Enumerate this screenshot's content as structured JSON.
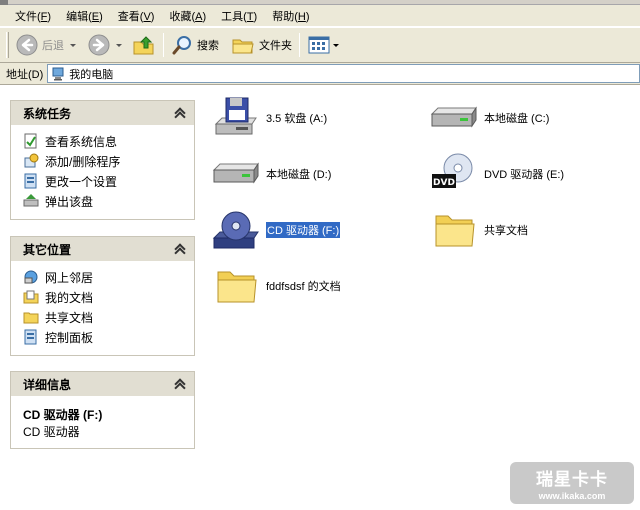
{
  "menubar": {
    "items": [
      {
        "label": "文件(",
        "hotkey": "F",
        "tail": ")"
      },
      {
        "label": "编辑(",
        "hotkey": "E",
        "tail": ")"
      },
      {
        "label": "查看(",
        "hotkey": "V",
        "tail": ")"
      },
      {
        "label": "收藏(",
        "hotkey": "A",
        "tail": ")"
      },
      {
        "label": "工具(",
        "hotkey": "T",
        "tail": ")"
      },
      {
        "label": "帮助(",
        "hotkey": "H",
        "tail": ")"
      }
    ]
  },
  "toolbar": {
    "back_label": "后退",
    "search_label": "搜索",
    "folders_label": "文件夹"
  },
  "address": {
    "label": "地址(D)",
    "value": "我的电脑"
  },
  "panes": {
    "system_tasks": {
      "title": "系统任务",
      "links": [
        "查看系统信息",
        "添加/删除程序",
        "更改一个设置",
        "弹出该盘"
      ]
    },
    "other_places": {
      "title": "其它位置",
      "links": [
        "网上邻居",
        "我的文档",
        "共享文档",
        "控制面板"
      ]
    },
    "details": {
      "title": "详细信息",
      "name": "CD 驱动器 (F:)",
      "type": "CD 驱动器"
    }
  },
  "items": [
    {
      "label": "3.5 软盘 (A:)",
      "icon": "floppy-drive-icon"
    },
    {
      "label": "本地磁盘 (C:)",
      "icon": "hard-disk-icon"
    },
    {
      "label": "本地磁盘 (D:)",
      "icon": "hard-disk-icon"
    },
    {
      "label": "DVD 驱动器 (E:)",
      "icon": "dvd-drive-icon"
    },
    {
      "label": "CD 驱动器 (F:)",
      "icon": "cd-drive-icon",
      "selected": true
    },
    {
      "label": "共享文档",
      "icon": "folder-icon"
    },
    {
      "label": "fddfsdsf 的文档",
      "icon": "folder-icon"
    }
  ],
  "watermark": {
    "title": "瑞星卡卡",
    "url": "www.ikaka.com"
  },
  "colors": {
    "selection": "#316ac5",
    "pane_header": "#e1ded2",
    "chrome": "#ece9d8"
  }
}
